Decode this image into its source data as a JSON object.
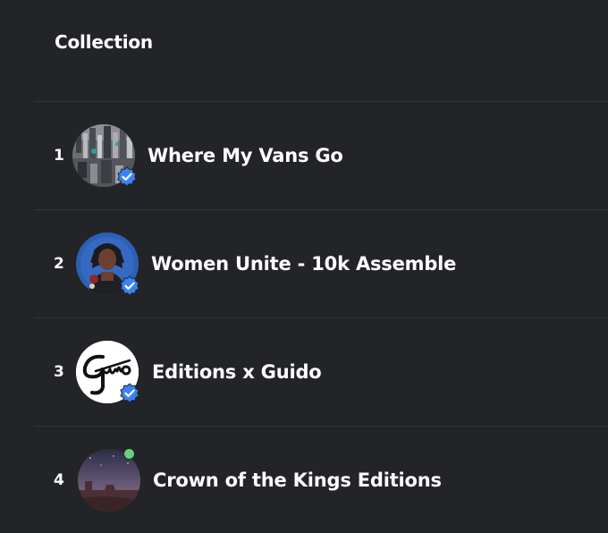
{
  "header": {
    "title": "Collection"
  },
  "collections": [
    {
      "rank": "1",
      "name": "Where My Vans Go",
      "verified": true,
      "avatar": "city-aerial-avatar"
    },
    {
      "rank": "2",
      "name": "Women Unite - 10k Assemble",
      "verified": true,
      "avatar": "woman-portrait-avatar"
    },
    {
      "rank": "3",
      "name": "Editions x Guido",
      "verified": true,
      "avatar": "guido-signature-avatar"
    },
    {
      "rank": "4",
      "name": "Crown of the Kings Editions",
      "verified": false,
      "online": true,
      "avatar": "desert-landscape-avatar"
    }
  ],
  "colors": {
    "background": "#232427",
    "divider": "#34363a",
    "verified_badge": "#3b82f6",
    "online_dot": "#6ad07a"
  }
}
